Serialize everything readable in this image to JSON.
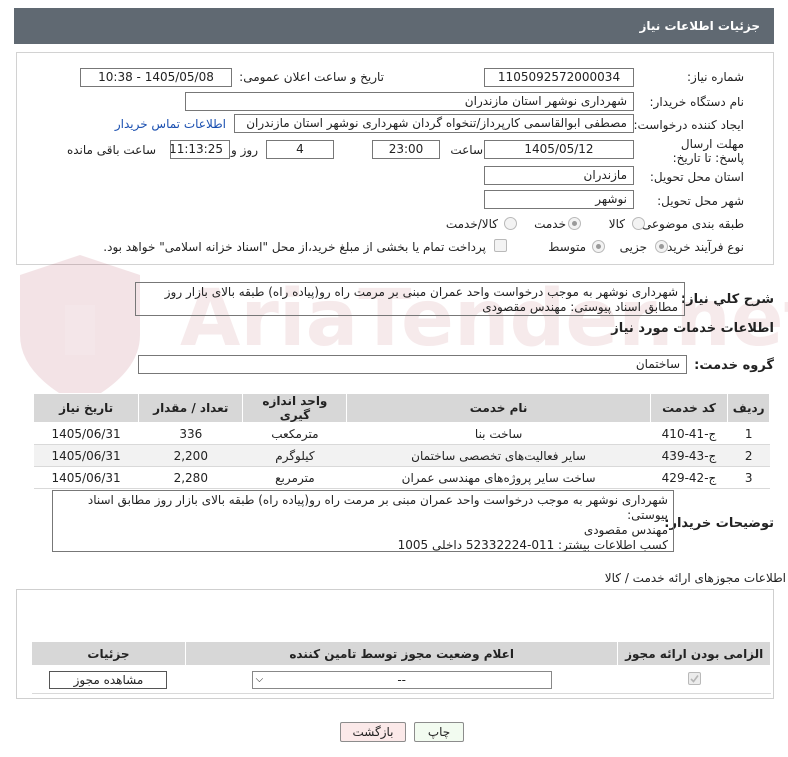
{
  "header": {
    "title": "جزئیات اطلاعات نیاز"
  },
  "form": {
    "need_number_label": "شماره نیاز:",
    "need_number": "1105092572000034",
    "announce_label": "تاریخ و ساعت اعلان عمومی:",
    "announce_value": "1405/05/08 - 10:38",
    "buyer_org_label": "نام دستگاه خریدار:",
    "buyer_org": "شهرداری نوشهر استان مازندران",
    "requester_label": "ایجاد کننده درخواست:",
    "requester": "مصطفی  ابوالقاسمی کارپرداز/تنخواه گردان شهرداری نوشهر استان مازندران",
    "contact_link": "اطلاعات تماس خریدار",
    "deadline_label": "مهلت ارسال پاسخ: تا تاریخ:",
    "deadline_date": "1405/05/12",
    "time_label": "ساعت",
    "deadline_time": "23:00",
    "days_value": "4",
    "days_label": "روز و",
    "remaining_time": "11:13:25",
    "remaining_label": "ساعت باقی مانده",
    "province_label": "استان محل تحویل:",
    "province": "مازندران",
    "city_label": "شهر محل تحویل:",
    "city": "نوشهر",
    "category_label": "طبقه بندی موضوعی:",
    "category_options": [
      "کالا",
      "خدمت",
      "کالا/خدمت"
    ],
    "category_selected": "خدمت",
    "process_label": "نوع فرآیند خرید :",
    "process_options": [
      "جزیی",
      "متوسط"
    ],
    "process_selected": "جزیی",
    "payment_note": "پرداخت تمام یا بخشی از مبلغ خرید،از محل \"اسناد خزانه اسلامی\" خواهد بود."
  },
  "summary": {
    "label": "شرح کلي نياز:",
    "text": "شهرداری نوشهر به موجب درخواست واحد عمران مبنی بر مرمت راه رو(پیاده راه) طبقه بالای بازار روز مطابق اسناد پیوستی: مهندس مقصودی"
  },
  "services": {
    "title": "اطلاعات خدمات مورد نیاز",
    "group_label": "گروه خدمت:",
    "group_value": "ساختمان",
    "columns": [
      "ردیف",
      "کد خدمت",
      "نام خدمت",
      "واحد اندازه گیری",
      "تعداد / مقدار",
      "تاریخ نیاز"
    ],
    "rows": [
      {
        "idx": "1",
        "code": "ج-41-410",
        "name": "ساخت بنا",
        "unit": "مترمکعب",
        "qty": "336",
        "date": "1405/06/31"
      },
      {
        "idx": "2",
        "code": "ج-43-439",
        "name": "سایر فعالیت‌های تخصصی ساختمان",
        "unit": "کیلوگرم",
        "qty": "2,200",
        "date": "1405/06/31"
      },
      {
        "idx": "3",
        "code": "ج-42-429",
        "name": "ساخت سایر پروژه‌های مهندسی عمران",
        "unit": "مترمربع",
        "qty": "2,280",
        "date": "1405/06/31"
      }
    ]
  },
  "buyer_notes": {
    "label": "توضیحات خریدار:",
    "line1": "شهرداری نوشهر به موجب درخواست واحد عمران مبنی بر مرمت راه رو(پیاده راه) طبقه بالای بازار روز مطابق اسناد پیوستی:",
    "line2": "مهندس مقصودی",
    "line3": "کسب اطلاعات بیشتر: 011-52332224 داخلی 1005"
  },
  "permits": {
    "title": "اطلاعات مجوزهای ارائه خدمت / کالا",
    "columns": [
      "الزامی بودن ارائه مجوز",
      "اعلام وضعیت مجوز توسط تامین کننده",
      "جزئیات"
    ],
    "select_value": "--",
    "view_button": "مشاهده مجوز"
  },
  "footer": {
    "print_button": "چاپ",
    "back_button": "بازگشت"
  },
  "watermark": {
    "text": "AriaTender.net"
  }
}
